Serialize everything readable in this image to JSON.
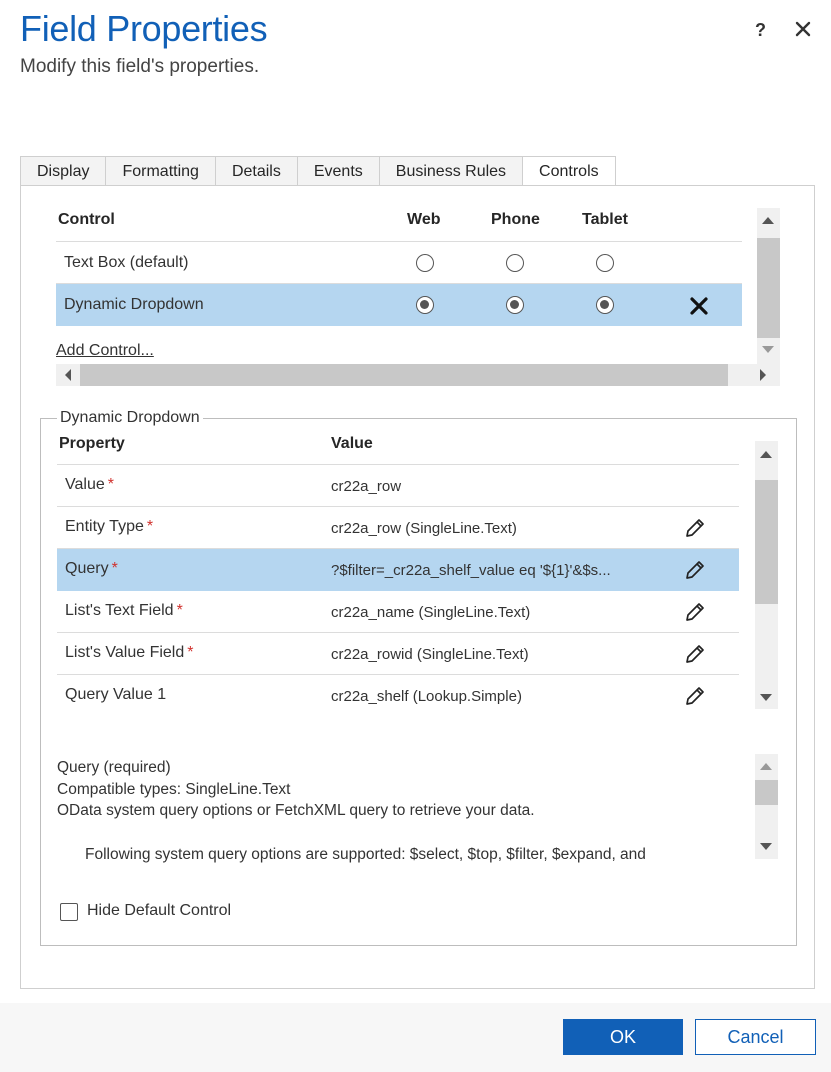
{
  "dialog": {
    "title": "Field Properties",
    "subtitle": "Modify this field's properties.",
    "help_label": "?"
  },
  "tabs": [
    {
      "label": "Display",
      "active": false
    },
    {
      "label": "Formatting",
      "active": false
    },
    {
      "label": "Details",
      "active": false
    },
    {
      "label": "Events",
      "active": false
    },
    {
      "label": "Business Rules",
      "active": false
    },
    {
      "label": "Controls",
      "active": true
    }
  ],
  "controls_table": {
    "headers": {
      "control": "Control",
      "web": "Web",
      "phone": "Phone",
      "tablet": "Tablet"
    },
    "rows": [
      {
        "name": "Text Box (default)",
        "web": false,
        "phone": false,
        "tablet": false,
        "selected": false
      },
      {
        "name": "Dynamic Dropdown",
        "web": true,
        "phone": true,
        "tablet": true,
        "selected": true,
        "remove_icon": "close-icon"
      }
    ],
    "add_control_label": "Add Control..."
  },
  "properties": {
    "legend": "Dynamic Dropdown",
    "headers": {
      "property": "Property",
      "value": "Value"
    },
    "required_marker": "*",
    "rows": [
      {
        "name": "Value",
        "required": true,
        "value": "cr22a_row",
        "editable": false,
        "selected": false
      },
      {
        "name": "Entity Type",
        "required": true,
        "value": "cr22a_row (SingleLine.Text)",
        "editable": true,
        "selected": false
      },
      {
        "name": "Query",
        "required": true,
        "value": "?$filter=_cr22a_shelf_value eq '${1}'&$s...",
        "editable": true,
        "selected": true
      },
      {
        "name": "List's Text Field",
        "required": true,
        "value": "cr22a_name (SingleLine.Text)",
        "editable": true,
        "selected": false
      },
      {
        "name": "List's Value Field",
        "required": true,
        "value": "cr22a_rowid (SingleLine.Text)",
        "editable": true,
        "selected": false
      },
      {
        "name": "Query Value 1",
        "required": false,
        "value": "cr22a_shelf (Lookup.Simple)",
        "editable": true,
        "selected": false
      }
    ],
    "description": {
      "line1": "Query (required)",
      "line2": "Compatible types: SingleLine.Text",
      "line3": "OData system query options or FetchXML query to retrieve your data.",
      "line4": "Following system query options are supported: $select, $top, $filter, $expand, and"
    },
    "hide_default_label": "Hide Default Control",
    "hide_default_checked": false
  },
  "footer": {
    "ok_label": "OK",
    "cancel_label": "Cancel"
  },
  "colors": {
    "accent": "#1160b7",
    "selected_row": "#b5d6f0",
    "required": "#d0312d"
  }
}
